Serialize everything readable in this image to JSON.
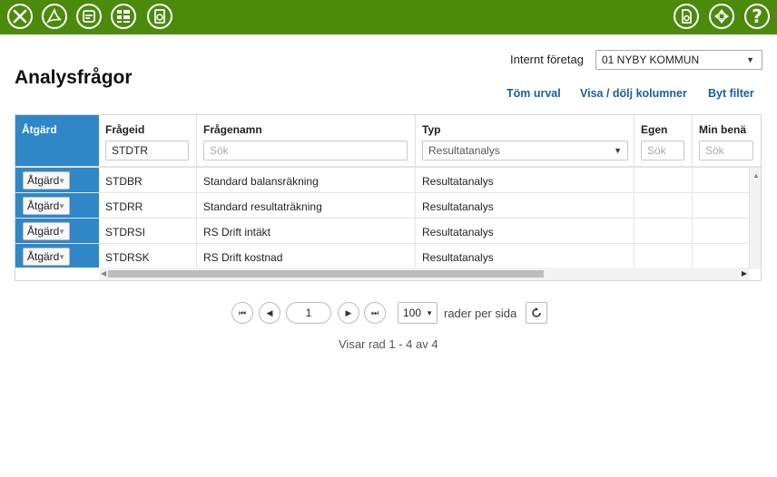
{
  "toolbar": {
    "left_icons": [
      "excel-icon",
      "pdf-icon",
      "print-icon",
      "columns-icon",
      "report-icon"
    ],
    "right_icons": [
      "export-icon",
      "expand-icon",
      "help-icon"
    ],
    "help_label": "?",
    "color": "#4c8a0c"
  },
  "company": {
    "label": "Internt företag",
    "value": "01 NYBY KOMMUN"
  },
  "page": {
    "title": "Analysfrågor"
  },
  "links": {
    "clear": "Töm urval",
    "columns": "Visa / dölj kolumner",
    "filter": "Byt filter"
  },
  "grid": {
    "headers": {
      "action": "Åtgärd",
      "id": "Frågeid",
      "name": "Frågenamn",
      "type": "Typ",
      "own": "Egen",
      "min": "Min benä"
    },
    "filters": {
      "id": "STDTR",
      "name_placeholder": "Sök",
      "type": "Resultatanalys",
      "own_placeholder": "Sök",
      "min_placeholder": "Sök"
    },
    "action_button": "Åtgärd",
    "rows": [
      {
        "id": "STDBR",
        "name": "Standard balansräkning",
        "type": "Resultatanalys"
      },
      {
        "id": "STDRR",
        "name": "Standard resultaträkning",
        "type": "Resultatanalys"
      },
      {
        "id": "STDRSI",
        "name": "RS Drift intäkt",
        "type": "Resultatanalys"
      },
      {
        "id": "STDRSK",
        "name": "RS Drift kostnad",
        "type": "Resultatanalys"
      }
    ],
    "accent_color": "#2f87c8"
  },
  "pager": {
    "page": "1",
    "page_size": "100",
    "page_size_label": "rader per sida",
    "info": "Visar rad 1 - 4 av 4"
  }
}
